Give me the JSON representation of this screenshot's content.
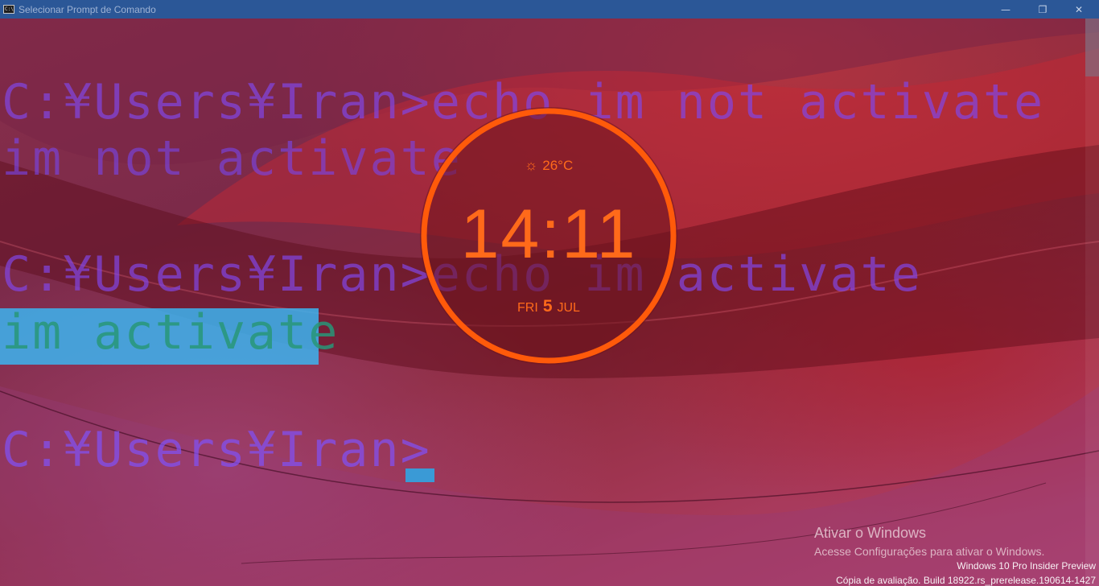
{
  "window": {
    "title": "Selecionar Prompt de Comando",
    "icon": "cmd-icon",
    "icon_text": "C:\\",
    "minimize_glyph": "—",
    "restore_glyph": "❐",
    "close_glyph": "✕"
  },
  "console": {
    "lines": [
      "C:¥Users¥Iran>echo im not activate",
      "im not activate",
      "C:¥Users¥Iran>echo im activate",
      "im activate",
      "C:¥Users¥Iran>"
    ],
    "selected_line_color": "#3cb4f0",
    "text_color": "#8246e6"
  },
  "clock_widget": {
    "weather_icon": "sun-cloud-icon",
    "temperature": "26°C",
    "time": "14:11",
    "weekday": "FRI",
    "day": "5",
    "month": "JUL",
    "accent_color": "#ff6a1a"
  },
  "watermark": {
    "title": "Ativar o Windows",
    "subtitle": "Acesse Configurações para ativar o Windows.",
    "edition": "Windows 10 Pro Insider Preview",
    "build": "Cópia de avaliação. Build 18922.rs_prerelease.190614-1427"
  }
}
